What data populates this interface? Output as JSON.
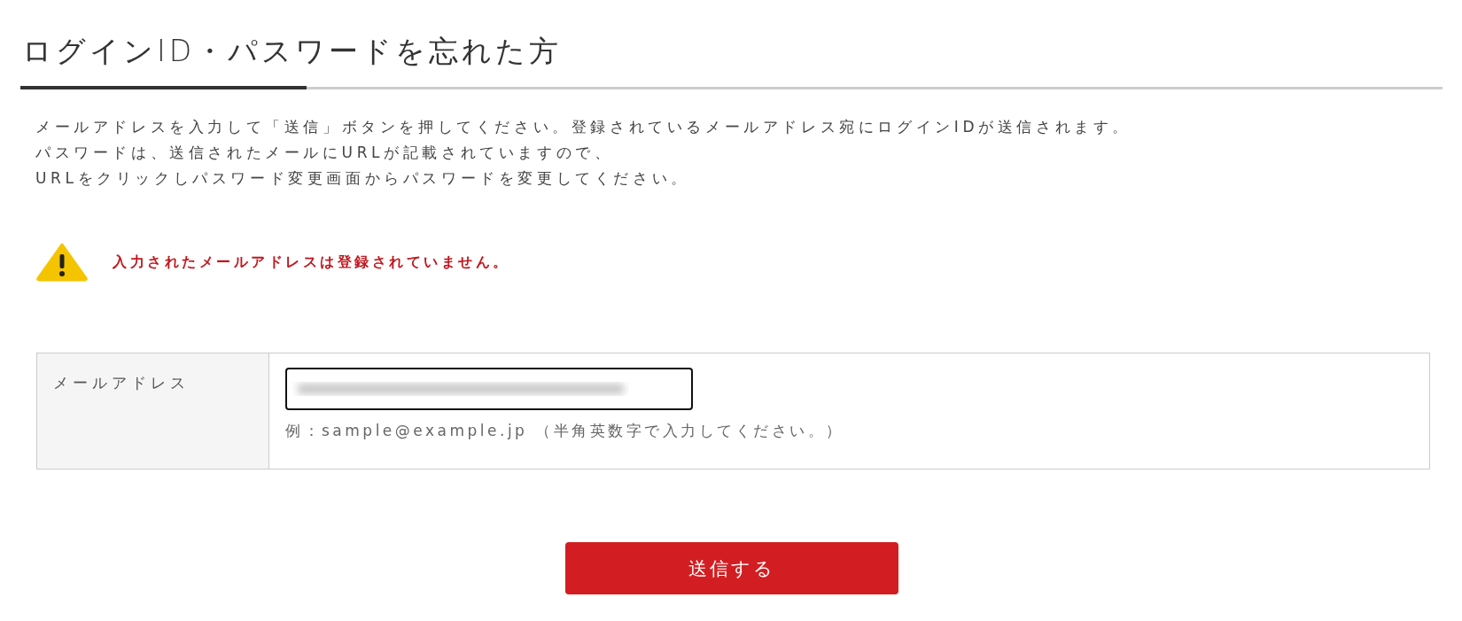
{
  "heading": "ログインID・パスワードを忘れた方",
  "instructions": [
    "メールアドレスを入力して「送信」ボタンを押してください。登録されているメールアドレス宛にログインIDが送信されます。",
    "パスワードは、送信されたメールにURLが記載されていますので、",
    "URLをクリックしパスワード変更画面からパスワードを変更してください。"
  ],
  "alert": {
    "kind": "warning",
    "message": "入力されたメールアドレスは登録されていません。"
  },
  "form": {
    "rows": [
      {
        "label": "メールアドレス",
        "redacted": true,
        "hint": "例：sample@example.jp （半角英数字で入力してください。）"
      }
    ]
  },
  "submit_button": "送信する"
}
